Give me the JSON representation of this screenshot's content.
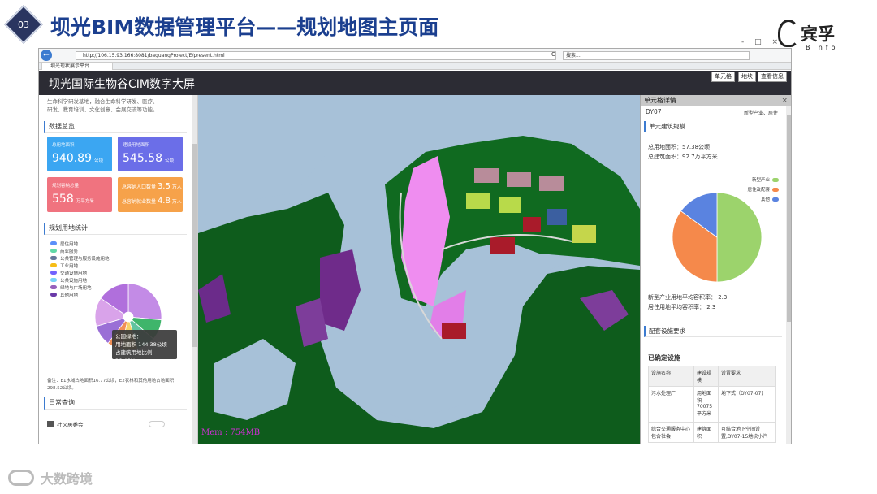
{
  "slide": {
    "number": "03",
    "title": "坝光BIM数据管理平台——规划地图主页面",
    "logo_name": "宾孚",
    "logo_sub": "Binfo",
    "watermark": "大数跨境"
  },
  "window_controls": [
    "-",
    "□",
    "×"
  ],
  "browser": {
    "url": "http://106.15.93.166:8081/baguangProject/E/present.html",
    "search_placeholder": "搜索...",
    "tab_title": "坝光现状展示平台",
    "refresh_label": "C",
    "back_label": "←"
  },
  "app": {
    "title": "坝光国际生物谷CIM数字大屏",
    "buttons": [
      "单元格",
      "地块",
      "查看信息"
    ]
  },
  "left": {
    "intro_line1": "生命科学研发基地，融合生命科学研发、医疗、",
    "intro_line2": "研发、教育培训、文化创意、会展交流等功能。",
    "overview_title": "数据总览",
    "cards": [
      {
        "label": "总用地面积",
        "value": "940.89",
        "unit": "公顷",
        "color": "#3ba6f2"
      },
      {
        "label": "建设用地面积",
        "value": "545.58",
        "unit": "公顷",
        "color": "#6b6ee8"
      },
      {
        "label": "规划容纳总量",
        "value": "558",
        "unit": "万平方米",
        "color": "#f0737f"
      }
    ],
    "card4_line1_label": "总容纳人口数量",
    "card4_line1_value": "3.5",
    "card4_line1_unit": "万人",
    "card4_line2_label": "总容纳就业数量",
    "card4_line2_value": "4.8",
    "card4_line2_unit": "万人",
    "card4_color": "#f6a24a",
    "landuse_title": "规划用地统计",
    "legend": [
      {
        "name": "居住用地",
        "color": "#5b8ff9"
      },
      {
        "name": "商业服务",
        "color": "#61d9a8"
      },
      {
        "name": "公共管理与服务设施用地",
        "color": "#65789b"
      },
      {
        "name": "工业用地",
        "color": "#f6bd16"
      },
      {
        "name": "交通设施用地",
        "color": "#7262fd"
      },
      {
        "name": "公共设施用地",
        "color": "#78d3f8"
      },
      {
        "name": "绿地与广场用地",
        "color": "#9661bc"
      },
      {
        "name": "其他用地",
        "color": "#6a3aa8"
      }
    ],
    "tooltip_title": "公园绿地：",
    "tooltip_area": "用地面积 144.38公顷",
    "tooltip_ratio": "占建筑用地比例 26.46%",
    "note": "备注：E1水域占地面积16.77公顷，E2农林和其他用地占地面积298.52公顷。",
    "query_title": "日常查询",
    "query_item": "社区居委会"
  },
  "map": {
    "memory_text": "Mem : 754MB"
  },
  "right": {
    "panel_title": "单元格详情",
    "close_label": "×",
    "cell_id": "DY07",
    "cell_type": "新型产业、居住",
    "scale_title": "单元建筑规模",
    "total_land": "总用地面积：57.38公顷",
    "total_building": "总建筑面积：92.7万平方米",
    "pie_legend": [
      {
        "name": "新型产业",
        "color": "#9cd36c"
      },
      {
        "name": "居住及配套",
        "color": "#f5894b"
      },
      {
        "name": "其他",
        "color": "#5a83e0"
      }
    ],
    "pie_values": [
      0.5,
      0.35,
      0.15
    ],
    "far1": "新型产业用地平均容积率：  2.3",
    "far2": "居住用地平均容积率：  2.3",
    "facility_title": "配套设施要求",
    "confirmed_title": "已确定设施",
    "table_headers": [
      "设施名称",
      "建设规模",
      "设置要求"
    ],
    "table_rows": [
      [
        "污水处理厂",
        "用地面积70075平方米",
        "地下式（DY07-07)"
      ],
      [
        "综合交通服务中心包含社会",
        "建筑面积",
        "可结合地下空间设置,DY07-15地块小汽"
      ]
    ]
  },
  "pie_chart_left": {
    "slices": [
      {
        "value": 26.46,
        "color": "#c38be6"
      },
      {
        "value": 10,
        "color": "#3fb56b"
      },
      {
        "value": 9,
        "color": "#61c4a0"
      },
      {
        "value": 8,
        "color": "#f6d36a"
      },
      {
        "value": 7,
        "color": "#f08f57"
      },
      {
        "value": 10,
        "color": "#9a6fd6"
      },
      {
        "value": 14,
        "color": "#d9a3ea"
      },
      {
        "value": 15.54,
        "color": "#b06fdc"
      }
    ]
  }
}
